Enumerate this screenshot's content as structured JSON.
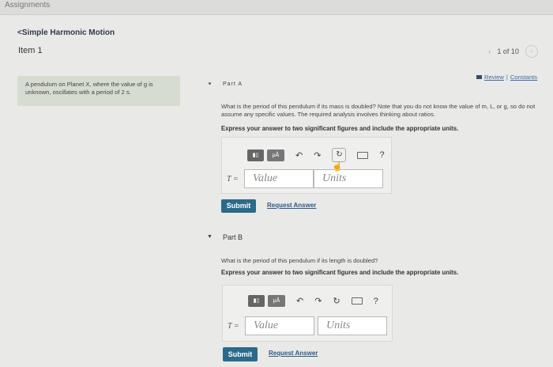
{
  "header": {
    "crumb": "Assignments",
    "back_link": "<Simple Harmonic Motion",
    "item": "Item 1"
  },
  "pager": {
    "prev": "‹",
    "position": "1 of 10",
    "next": "›"
  },
  "problem": {
    "text": "A pendulum on Planet X, where the value of g is unknown, oscillates with a period of 2 s."
  },
  "links": {
    "review": "Review",
    "sep": "|",
    "constants": "Constants"
  },
  "partA": {
    "label": "Part A",
    "question": "What is the period of this pendulum if its mass is doubled? Note that you do not know the value of m, L, or g, so do not assume any specific values. The required analysis involves thinking about ratios.",
    "instruction": "Express your answer to two significant figures and include the appropriate units.",
    "var": "T =",
    "value_placeholder": "Value",
    "units_placeholder": "Units",
    "submit": "Submit",
    "request": "Request Answer"
  },
  "partB": {
    "label": "Part B",
    "question": "What is the period of this pendulum if its length is doubled?",
    "instruction": "Express your answer to two significant figures and include the appropriate units.",
    "var": "T =",
    "value_placeholder": "Value",
    "units_placeholder": "Units",
    "submit": "Submit",
    "request": "Request Answer"
  },
  "toolbar": {
    "templates": "▮▯",
    "mu": "μÅ",
    "undo": "↶",
    "redo": "↷",
    "reset": "↻",
    "keyboard": "",
    "help": "?"
  }
}
